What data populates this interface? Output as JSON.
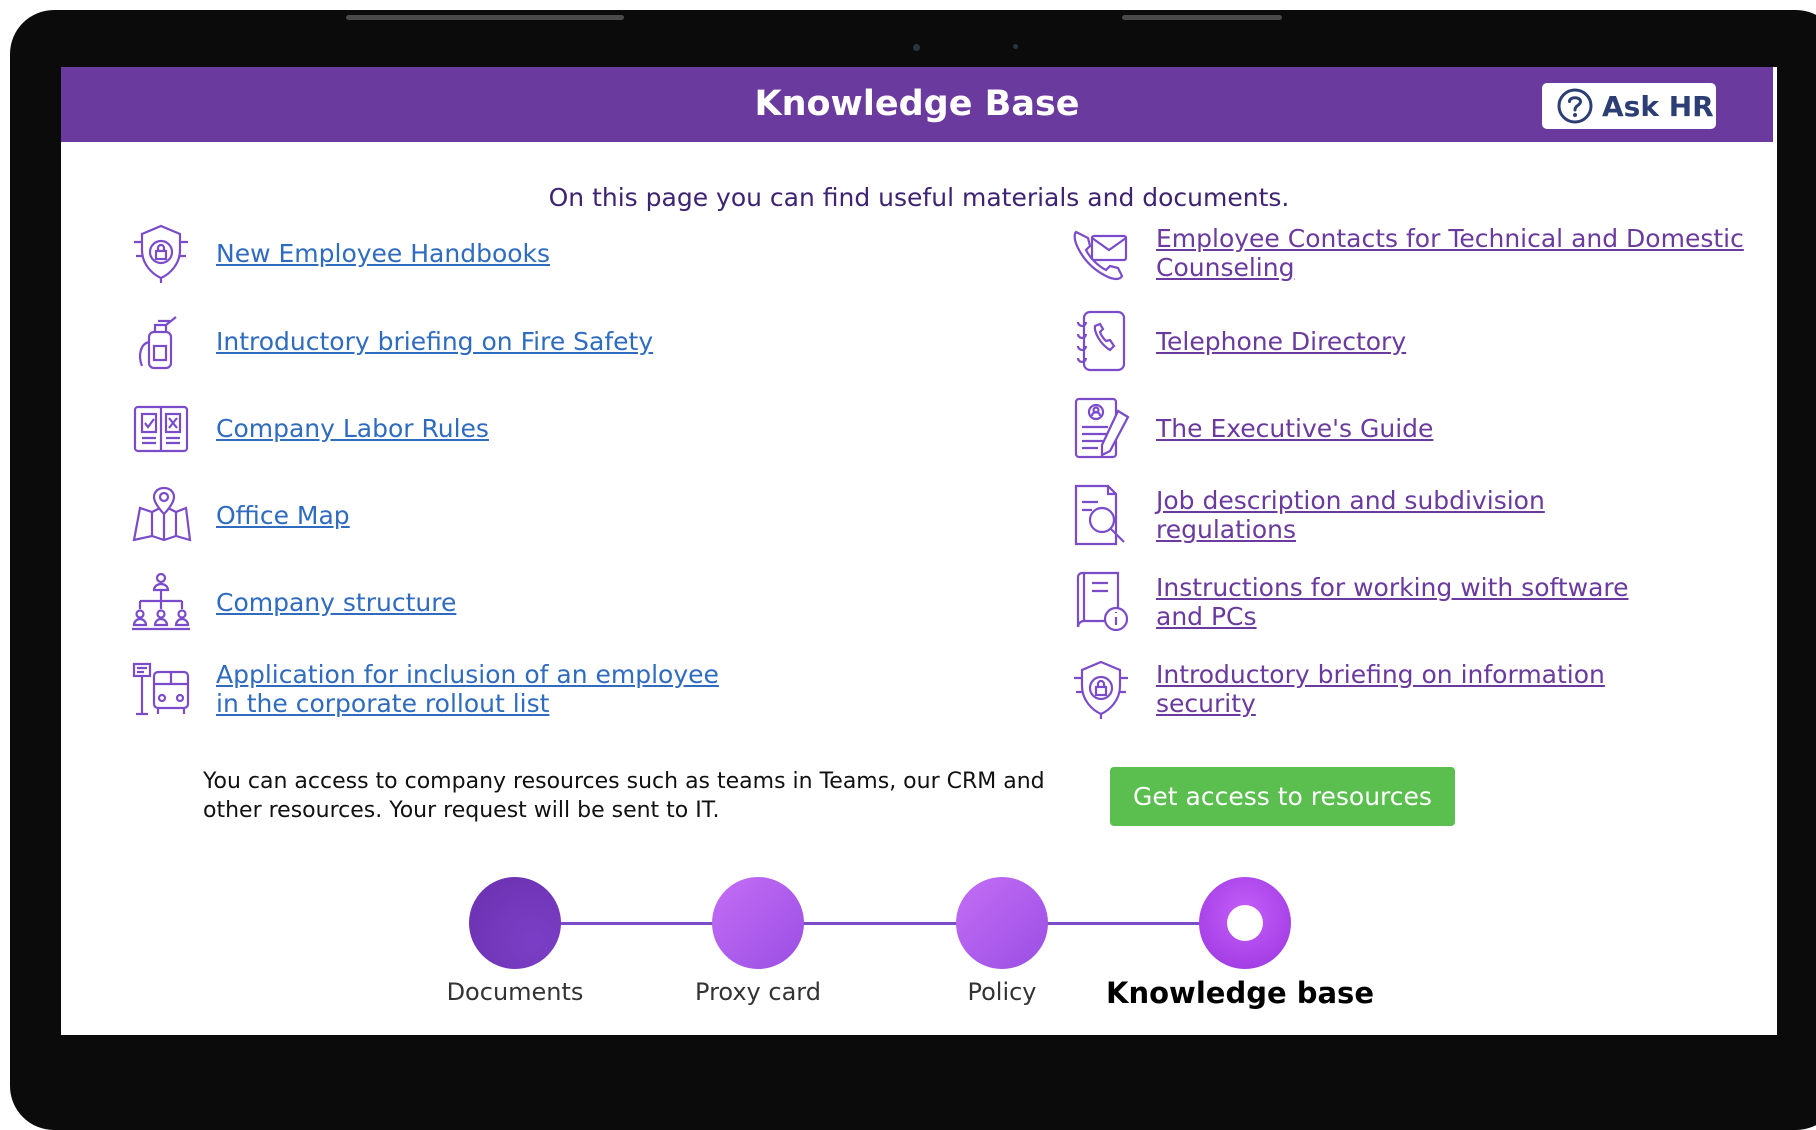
{
  "app": {
    "title": "Knowledge Base",
    "ask_hr": "Ask HR"
  },
  "subtitle": "On this page you can find useful materials and documents.",
  "left_links": [
    {
      "label": "New Employee Handbooks",
      "icon": "shield-lock-icon"
    },
    {
      "label": "Introductory briefing on Fire Safety",
      "icon": "fire-extinguisher-icon"
    },
    {
      "label": "Company Labor Rules",
      "icon": "rules-book-icon"
    },
    {
      "label": "Office Map",
      "icon": "map-pin-icon"
    },
    {
      "label": "Company structure",
      "icon": "org-chart-icon"
    },
    {
      "label_line1": "Application for inclusion of an employee",
      "label_line2": "in the corporate rollout list",
      "icon": "bus-icon"
    }
  ],
  "right_links": [
    {
      "label_line1": "Employee Contacts for Technical and Domestic",
      "label_line2": "Counseling",
      "icon": "phone-mail-icon"
    },
    {
      "label": "Telephone Directory",
      "icon": "phone-book-icon"
    },
    {
      "label": "The Executive's Guide",
      "icon": "document-pen-icon"
    },
    {
      "label_line1": "Job description and subdivision",
      "label_line2": "regulations",
      "icon": "document-search-icon"
    },
    {
      "label_line1": "Instructions for working with software",
      "label_line2": "and PCs",
      "icon": "manual-info-icon"
    },
    {
      "label_line1": "Introductory briefing on information",
      "label_line2": "security",
      "icon": "security-shield-icon"
    }
  ],
  "info_text": "You can access to company resources such as teams in Teams, our CRM and other resources. Your request will be sent to IT.",
  "get_access_button": "Get access to resources",
  "steps": [
    {
      "label": "Documents"
    },
    {
      "label": "Proxy card"
    },
    {
      "label": "Policy"
    },
    {
      "label": "Knowledge base",
      "active": true
    }
  ],
  "colors": {
    "header": "#6a3a9e",
    "link": "#2f6bbf",
    "link_right": "#6a3a9e",
    "button": "#5abf4e",
    "step_dark": "#6e37b8",
    "step_light": "#b05bef"
  }
}
